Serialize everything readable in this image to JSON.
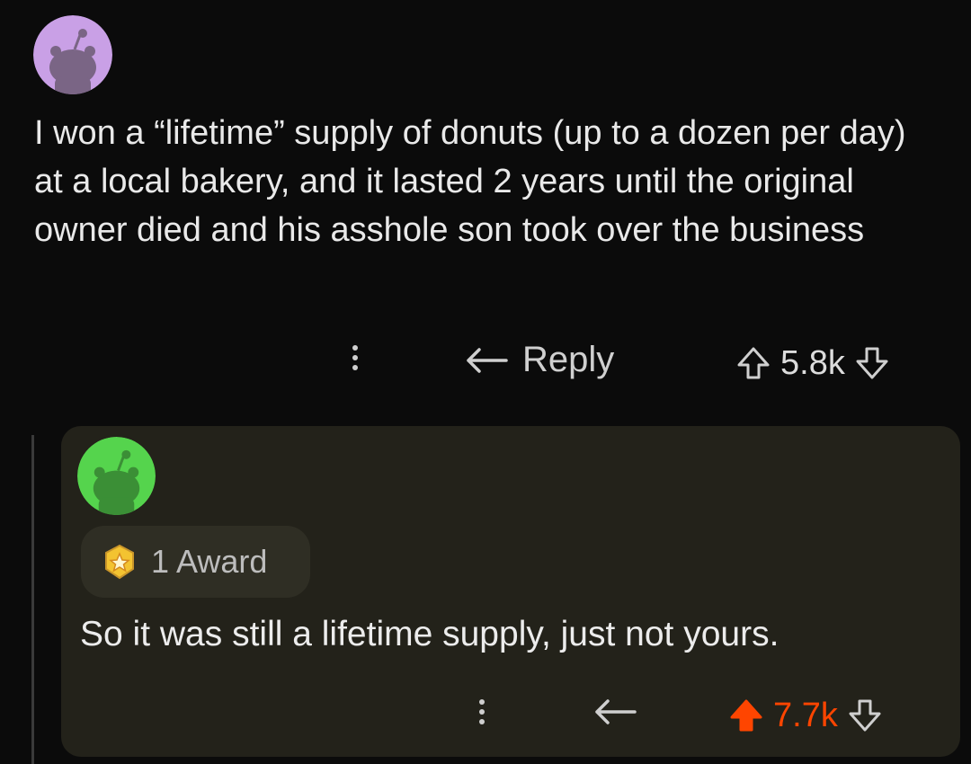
{
  "post": {
    "avatar_icon": "snoo-avatar-purple",
    "avatar_color": "#c9a0e6",
    "body": "I won a “lifetime” supply of donuts (up to a dozen per day) at a local bakery, and it lasted 2 years until the original owner died and his asshole son took over the business",
    "reply_label": "Reply",
    "vote_count": "5.8k",
    "more_icon": "more-vertical-icon",
    "reply_icon": "reply-arrow-icon",
    "upvote_icon": "upvote-arrow-icon",
    "downvote_icon": "downvote-arrow-icon"
  },
  "reply": {
    "avatar_icon": "snoo-avatar-green",
    "avatar_color": "#55d44d",
    "award_icon": "award-badge-icon",
    "award_label": "1 Award",
    "body": "So it was still a lifetime supply, just not yours.",
    "vote_count": "7.7k",
    "upvoted": true,
    "upvote_color": "#ff4500",
    "more_icon": "more-vertical-icon",
    "reply_icon": "reply-arrow-icon",
    "upvote_icon": "upvote-filled-icon",
    "downvote_icon": "downvote-arrow-icon"
  }
}
